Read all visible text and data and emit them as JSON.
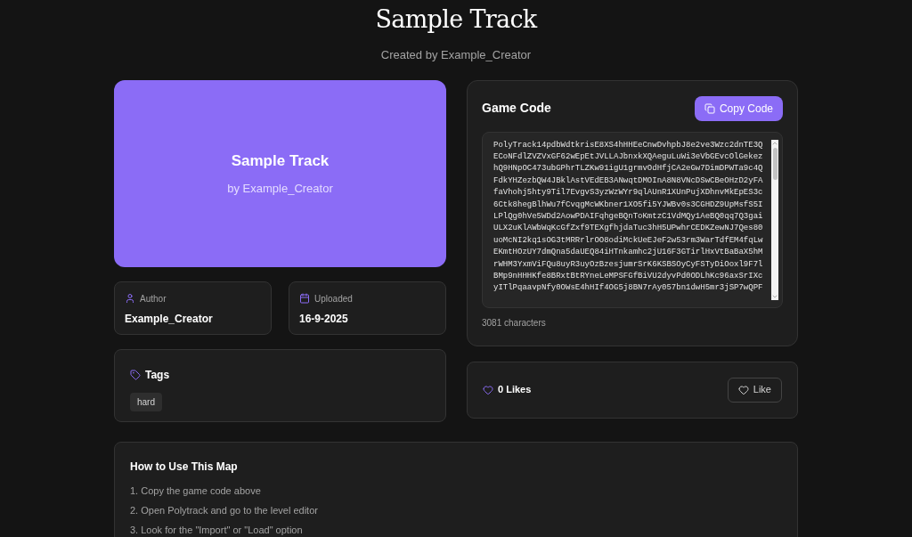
{
  "header": {
    "title": "Sample Track",
    "subtitle": "Created by Example_Creator"
  },
  "hero": {
    "title": "Sample Track",
    "byline": "by Example_Creator"
  },
  "meta": [
    {
      "kind": "author",
      "label": "Author",
      "value": "Example_Creator"
    },
    {
      "kind": "uploaded",
      "label": "Uploaded",
      "value": "16-9-2025"
    }
  ],
  "tags": {
    "title": "Tags",
    "items": [
      "hard"
    ]
  },
  "game_code": {
    "title": "Game Code",
    "copy_button": "Copy Code",
    "lines": [
      "PolyTrack14pdbWdtkrisE8XS4hHHEeCnwDvhpbJ8e2ve3Wzc2dnTE3Q",
      "ECoNFdlZVZVxGF62wEpEtJVLLAJbnxkXQAeguLuWi3eVbGEvcOlGekez",
      "hQ9HNpOC473ubGPhrTLZKw91igU1grmvOdHfjCA2eGw7DimDPWTa9c4Q",
      "FdkYHZezbQW4JBklAstVEdEB3ANwqtDMOInA8N8VNcDSwCBeOHzD2yFA",
      "faVhohj5hty9Til7EvgvS3yzWzWYr9qlAUnR1XUnPujXDhnvMkEpES3c",
      "6Ctk8hegBlhWu7fCvqgMcWKbner1XO5fi5YJWBv0s3CGHDZ9UpMsfS5I",
      "LPlQg0hVe5WDd2AowPDAIFqhgeBQnToKmtzC1VdMQy1AeBQ0qq7Q3gai",
      "ULX2uKlAWbWqKcGfZxf9TEXgfhjdaTuc3hH5UPwhrCEDKZewNJ7Qes80",
      "uoMcNI2kq1sOG3tMRRrlrOO8odiMckUeEJeF2w53rm3WarTdfEM4fqLw",
      "EKmtHOzUY7dmQna5daUEQ84iHTnkamhc2jU16F3GTirlHxVtBaBaX5hM",
      "rWHM3YxmViFQu8uyR3uyOzBzesjumrSrK6KSBSOyCyFSTyDiOoxl9F7l",
      "BMp9nHHHKfe8BRxtBtRYneLeMPSFGfBiVU2dyvPd0ODLhKc96axSrIXc",
      "yITlPqaavpNfy0OWsE4hHIf4OG5j8BN7rAy057bn1dwH5mr3jSP7wQPF"
    ],
    "count": "3081 characters"
  },
  "likes": {
    "count": "0 Likes",
    "button": "Like"
  },
  "how_to": {
    "title": "How to Use This Map",
    "steps": [
      "1. Copy the game code above",
      "2. Open Polytrack and go to the level editor",
      "3. Look for the \"Import\" or \"Load\" option"
    ]
  }
}
